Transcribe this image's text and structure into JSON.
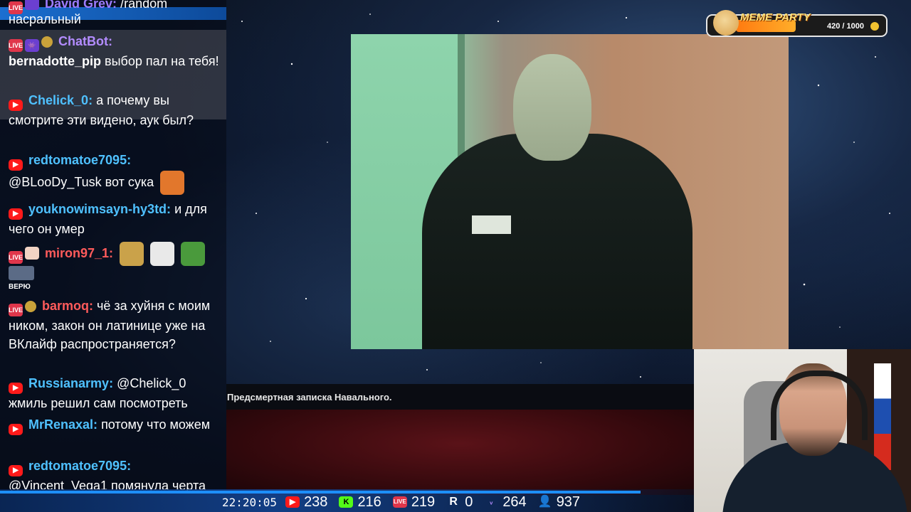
{
  "chat": {
    "messages": [
      {
        "name": "David Grev:",
        "text": "/random",
        "name_color": "#9d7cff",
        "badges": [
          "live",
          "mod"
        ]
      },
      {
        "name": "",
        "text": "насральный",
        "name_color": "#ffffff",
        "badges": []
      },
      {
        "name": "ChatBot:",
        "text": "bernadotte_pip выбор пал на тебя!",
        "mention": "bernadotte_pip",
        "rest": "выбор пал на тебя!",
        "name_color": "#b38cff",
        "badges": [
          "live",
          "mod",
          "coin"
        ]
      },
      {
        "name": "Chelick_0:",
        "text": "а почему вы смотрите эти видено, аук был?",
        "name_color": "#4fc1ff",
        "badges": [
          "youtube"
        ]
      },
      {
        "name": "redtomatoe7095:",
        "text": "@BLooDy_Tusk вот сука",
        "name_color": "#4fc1ff",
        "badges": [
          "youtube"
        ]
      },
      {
        "name": "youknowimsayn-hy3td:",
        "text": "и для чего он умер",
        "name_color": "#4fc1ff",
        "badges": [
          "youtube"
        ]
      },
      {
        "name": "miron97_1:",
        "text": "",
        "name_color": "#ff5b5b",
        "badges": [
          "live",
          "emote"
        ]
      },
      {
        "name": "",
        "text": "ВЕРЮ",
        "name_color": "#ffffff",
        "badges": []
      },
      {
        "name": "barmoq:",
        "text": "чё за хуйня с моим ником, закон он латинице уже на ВКлайф распространяется?",
        "name_color": "#ff5b5b",
        "badges": [
          "live",
          "coin"
        ]
      },
      {
        "name": "Russianarmy:",
        "text": "@Chelick_0 жмиль решил сам посмотреть",
        "name_color": "#4fc1ff",
        "badges": [
          "youtube"
        ]
      },
      {
        "name": "MrRenaxal:",
        "text": "потому что можем",
        "name_color": "#4fc1ff",
        "badges": [
          "youtube"
        ]
      },
      {
        "name": "redtomatoe7095:",
        "text": "@Vincent_Vega1 помянула черта",
        "name_color": "#4fc1ff",
        "badges": [
          "youtube"
        ]
      }
    ]
  },
  "video": {
    "caption": "Предсмертная записка Навального."
  },
  "meme_party": {
    "title": "MEME PARTY",
    "count": "420 / 1000",
    "progress": 0.42
  },
  "stats": {
    "time": "22:20:05",
    "youtube": "238",
    "kick": "216",
    "vklive": "219",
    "rutube": "0",
    "vk": "264",
    "total": "937"
  },
  "icons": {
    "youtube": "youtube-icon",
    "kick": "kick-icon",
    "vklive": "live-icon",
    "rutube": "rutube-icon",
    "vk": "vk-icon",
    "viewers": "user-icon"
  },
  "colors": {
    "youtube": "#ff1a1a",
    "kick": "#53fc18",
    "live": "#e0364b",
    "accent": "#1d8fff"
  }
}
